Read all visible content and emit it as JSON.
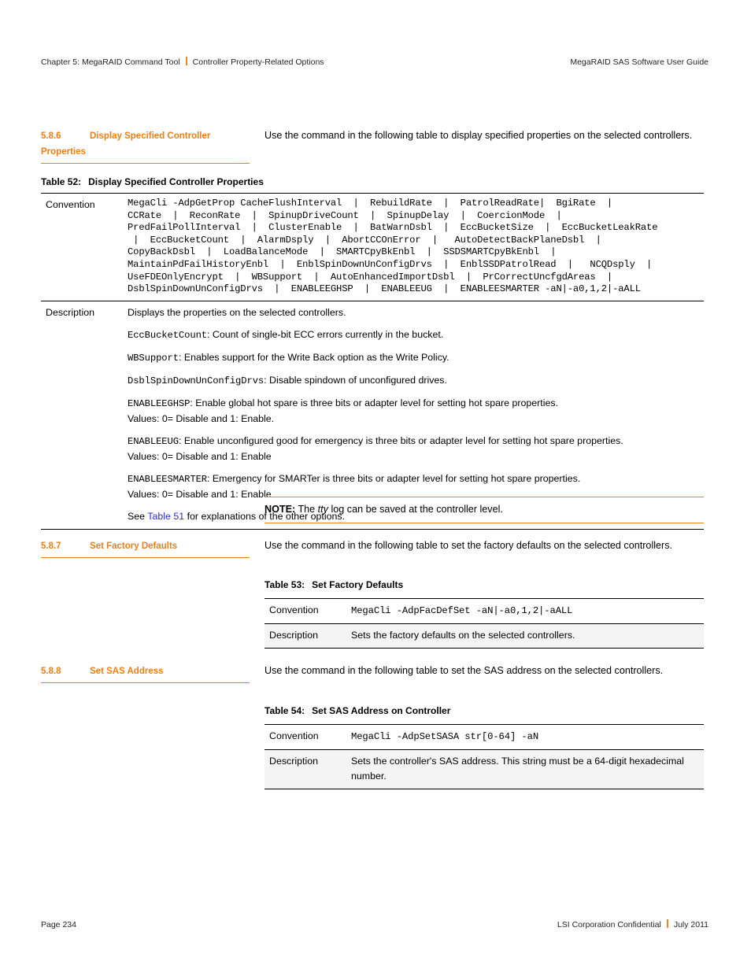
{
  "header": {
    "chapter": "Chapter 5: MegaRAID Command Tool",
    "section": "Controller Property-Related Options",
    "guide": "MegaRAID SAS Software User Guide",
    "divider_color": "#f08521"
  },
  "footer": {
    "page": "Page 234",
    "confidential": "LSI Corporation Confidential",
    "date": "July 2011",
    "divider_color": "#f08521"
  },
  "accent_color": "#f07f13",
  "link_color": "#2a2ae6",
  "sections": [
    {
      "number": "5.8.6",
      "title": "Display Specified Controller Properties",
      "intro": "Use the command in the following table to display specified properties on the selected controllers."
    },
    {
      "number": "5.8.7",
      "title": "Set Factory Defaults",
      "intro": "Use the command in the following table to set the factory defaults on the selected controllers."
    },
    {
      "number": "5.8.8",
      "title": "Set SAS Address",
      "intro": "Use the command in the following table to set the SAS address on the selected controllers."
    }
  ],
  "table52": {
    "caption_number": "Table 52:",
    "caption_title": "Display Specified Controller Properties",
    "convention_label": "Convention",
    "convention_value": "MegaCli -AdpGetProp CacheFlushInterval  |  RebuildRate  |  PatrolReadRate|  BgiRate  |\nCCRate  |  ReconRate  |  SpinupDriveCount  |  SpinupDelay  |  CoercionMode  |\nPredFailPollInterval  |  ClusterEnable  |  BatWarnDsbl  |  EccBucketSize  |  EccBucketLeakRate\n |  EccBucketCount  |  AlarmDsply  |  AbortCCOnError  |   AutoDetectBackPlaneDsbl  |\nCopyBackDsbl  |  LoadBalanceMode  |  SMARTCpyBkEnbl  |  SSDSMARTCpyBkEnbl  |\nMaintainPdFailHistoryEnbl  |  EnblSpinDownUnConfigDrvs  |  EnblSSDPatrolRead  |   NCQDsply  |\nUseFDEOnlyEncrypt  |  WBSupport  |  AutoEnhancedImportDsbl  |  PrCorrectUncfgdAreas  |\nDsblSpinDownUnConfigDrvs  |  ENABLEEGHSP  |  ENABLEEUG  |  ENABLEESMARTER -aN|-a0,1,2|-aALL",
    "description_label": "Description",
    "description_intro": "Displays the properties on the selected controllers.",
    "entries": [
      {
        "term": "EccBucketCount",
        "text": ": Count of single-bit ECC errors currently in the bucket.",
        "values": ""
      },
      {
        "term": "WBSupport",
        "text": ": Enables support for the Write Back option as the Write Policy.",
        "values": ""
      },
      {
        "term": "DsblSpinDownUnConfigDrvs",
        "text": ": Disable spindown of unconfigured drives.",
        "values": ""
      },
      {
        "term": "ENABLEEGHSP",
        "text": ": Enable global hot spare is three bits or adapter level for setting hot spare properties.",
        "values": "Values: 0= Disable and 1: Enable."
      },
      {
        "term": "ENABLEEUG",
        "text": ": Enable unconfigured good for emergency is three bits or adapter level for setting hot spare properties.",
        "values": "Values: 0= Disable and 1: Enable"
      },
      {
        "term": "ENABLEESMARTER",
        "text": ": Emergency for SMARTer is three bits or adapter level for setting hot spare properties.",
        "values": "Values: 0= Disable and 1: Enable"
      }
    ],
    "see_prefix": "See ",
    "see_link": "Table 51",
    "see_suffix": " for explanations of the other options."
  },
  "note": {
    "label": "NOTE:",
    "text_before": " The ",
    "emphasis": "tty",
    "text_after": " log can be saved at the controller level."
  },
  "table53": {
    "caption_number": "Table 53:",
    "caption_title": "Set Factory Defaults",
    "convention_label": "Convention",
    "convention_value": "MegaCli -AdpFacDefSet -aN|-a0,1,2|-aALL",
    "description_label": "Description",
    "description_value": "Sets the factory defaults on the selected controllers."
  },
  "table54": {
    "caption_number": "Table 54:",
    "caption_title": "Set SAS Address on Controller",
    "convention_label": "Convention",
    "convention_value": "MegaCli -AdpSetSASA str[0-64] -aN",
    "description_label": "Description",
    "description_value": "Sets the controller's SAS address. This string must be a 64-digit hexadecimal number."
  }
}
